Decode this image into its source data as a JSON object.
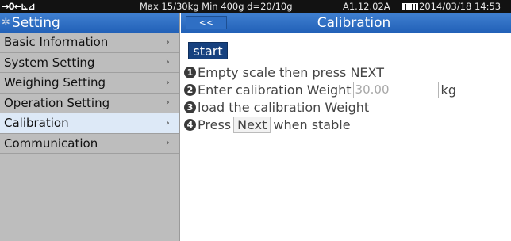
{
  "statusbar": {
    "icons": "→0←⊾⊿",
    "specs": "Max 15/30kg  Min 400g  d=20/10g",
    "version": "A1.12.02A",
    "datetime": "2014/03/18  14:53"
  },
  "sidebar": {
    "title": "Setting",
    "items": [
      {
        "label": "Basic Information"
      },
      {
        "label": "System Setting"
      },
      {
        "label": "Weighing Setting"
      },
      {
        "label": "Operation Setting"
      },
      {
        "label": "Calibration",
        "active": true
      },
      {
        "label": "Communication"
      }
    ]
  },
  "main": {
    "back_label": "<<",
    "title": "Calibration",
    "start_label": "start",
    "steps": {
      "s1": {
        "num": "1",
        "text": "Empty scale then press NEXT"
      },
      "s2": {
        "num": "2",
        "text": "Enter  calibration Weight",
        "value": "30.00",
        "unit": "kg"
      },
      "s3": {
        "num": "3",
        "text": "load the calibration Weight"
      },
      "s4": {
        "num": "4",
        "text_before": "Press",
        "next": "Next",
        "text_after": "when stable"
      }
    }
  },
  "colors": {
    "header_blue": "#2a68bf",
    "sidebar_gray": "#bdbdbd",
    "active_item": "#dde9f7",
    "start_button": "#16417f"
  }
}
